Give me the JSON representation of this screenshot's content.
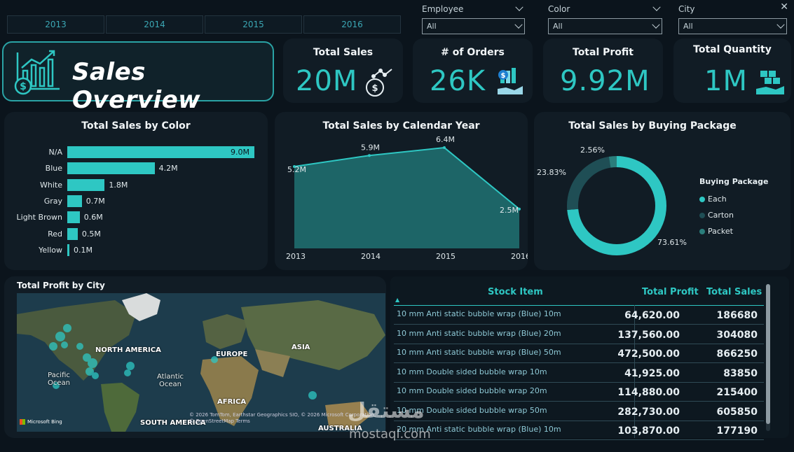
{
  "slicers": {
    "years": [
      "2013",
      "2014",
      "2015",
      "2016"
    ],
    "employee": {
      "label": "Employee",
      "value": "All"
    },
    "color": {
      "label": "Color",
      "value": "All"
    },
    "city": {
      "label": "City",
      "value": "All"
    }
  },
  "header": {
    "title": "Sales Overview"
  },
  "kpis": [
    {
      "title": "Total Sales",
      "value": "20M",
      "icon": "money-growth-icon"
    },
    {
      "title": "# of Orders",
      "value": "26K",
      "icon": "hand-money-icon"
    },
    {
      "title": "Total Profit",
      "value": "9.92M",
      "icon": "none"
    },
    {
      "title": "Total Quantity",
      "value": "1M",
      "icon": "hand-boxes-icon"
    }
  ],
  "colors": {
    "accent": "#2ec7c3",
    "background": "#0b141c",
    "card": "#111c25"
  },
  "sales_by_color": {
    "title": "Total Sales by Color",
    "bars": [
      {
        "label": "N/A",
        "value": "9.0M",
        "num": 9.0
      },
      {
        "label": "Blue",
        "value": "4.2M",
        "num": 4.2
      },
      {
        "label": "White",
        "value": "1.8M",
        "num": 1.8
      },
      {
        "label": "Gray",
        "value": "0.7M",
        "num": 0.7
      },
      {
        "label": "Light Brown",
        "value": "0.6M",
        "num": 0.6
      },
      {
        "label": "Red",
        "value": "0.5M",
        "num": 0.5
      },
      {
        "label": "Yellow",
        "value": "0.1M",
        "num": 0.1
      }
    ]
  },
  "sales_by_year": {
    "title": "Total Sales by Calendar Year",
    "points": [
      {
        "year": "2013",
        "label": "5.2M",
        "num": 5.2
      },
      {
        "year": "2014",
        "label": "5.9M",
        "num": 5.9
      },
      {
        "year": "2015",
        "label": "6.4M",
        "num": 6.4
      },
      {
        "year": "2016",
        "label": "2.5M",
        "num": 2.5
      }
    ]
  },
  "sales_by_package": {
    "title": "Total Sales by Buying Package",
    "legend_title": "Buying Package",
    "slices": [
      {
        "name": "Each",
        "label": "73.61%",
        "pct": 73.61,
        "color": "#2ec7c3"
      },
      {
        "name": "Carton",
        "label": "23.83%",
        "pct": 23.83,
        "color": "#1f4e55"
      },
      {
        "name": "Packet",
        "label": "2.56%",
        "pct": 2.56,
        "color": "#2a7d7b"
      }
    ]
  },
  "chart_data": [
    {
      "type": "bar",
      "title": "Total Sales by Color",
      "categories": [
        "N/A",
        "Blue",
        "White",
        "Gray",
        "Light Brown",
        "Red",
        "Yellow"
      ],
      "values": [
        9.0,
        4.2,
        1.8,
        0.7,
        0.6,
        0.5,
        0.1
      ]
    },
    {
      "type": "area",
      "title": "Total Sales by Calendar Year",
      "x": [
        "2013",
        "2014",
        "2015",
        "2016"
      ],
      "values": [
        5.2,
        5.9,
        6.4,
        2.5
      ]
    },
    {
      "type": "pie",
      "title": "Total Sales by Buying Package",
      "categories": [
        "Each",
        "Carton",
        "Packet"
      ],
      "values": [
        73.61,
        23.83,
        2.56
      ]
    }
  ],
  "map": {
    "title": "Total Profit by City",
    "labels": [
      "NORTH AMERICA",
      "EUROPE",
      "ASIA",
      "Pacific Ocean",
      "Atlantic Ocean",
      "AFRICA",
      "SOUTH AMERICA",
      "AUSTRALIA"
    ],
    "attribution": "© 2026 TomTom, Earthstar Geographics SIO, © 2026 Microsoft Corporation, © OpenStreetMap Terms",
    "brand": "Microsoft Bing"
  },
  "table": {
    "headers": {
      "item": "Stock Item",
      "profit": "Total Profit",
      "sales": "Total Sales"
    },
    "rows": [
      {
        "item": "10 mm Anti static bubble wrap (Blue) 10m",
        "profit": "64,620.00",
        "sales": "186680"
      },
      {
        "item": "10 mm Anti static bubble wrap (Blue) 20m",
        "profit": "137,560.00",
        "sales": "304080"
      },
      {
        "item": "10 mm Anti static bubble wrap (Blue) 50m",
        "profit": "472,500.00",
        "sales": "866250"
      },
      {
        "item": "10 mm Double sided bubble wrap 10m",
        "profit": "41,925.00",
        "sales": "83850"
      },
      {
        "item": "10 mm Double sided bubble wrap 20m",
        "profit": "114,880.00",
        "sales": "215400"
      },
      {
        "item": "10 mm Double sided bubble wrap 50m",
        "profit": "282,730.00",
        "sales": "605850"
      },
      {
        "item": "20 mm Anti static bubble wrap (Blue) 10m",
        "profit": "103,870.00",
        "sales": "177190"
      }
    ]
  },
  "watermark": {
    "text": "mostaql.com",
    "arabic": "مستقل"
  }
}
